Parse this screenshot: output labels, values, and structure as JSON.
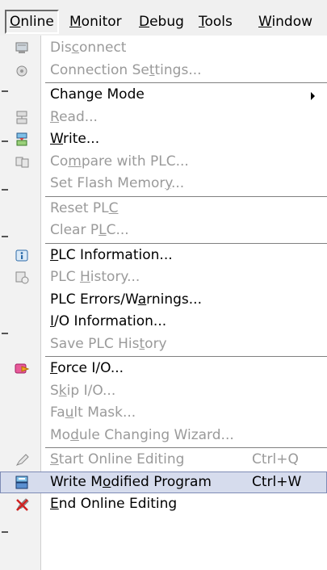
{
  "menubar": {
    "items": [
      {
        "pre": "",
        "ul": "O",
        "post": "nline"
      },
      {
        "pre": "",
        "ul": "M",
        "post": "onitor"
      },
      {
        "pre": "",
        "ul": "D",
        "post": "ebug"
      },
      {
        "pre": "",
        "ul": "T",
        "post": "ools"
      },
      {
        "pre": "",
        "ul": "W",
        "post": "indow"
      }
    ]
  },
  "menu": {
    "disconnect": {
      "pre": "Dis",
      "ul": "c",
      "post": "onnect"
    },
    "connection_settings": {
      "pre": "Connection Se",
      "ul": "t",
      "post": "tings..."
    },
    "change_mode": {
      "pre": "Chan",
      "ul": "g",
      "post": "e Mode"
    },
    "read": {
      "pre": "",
      "ul": "R",
      "post": "ead..."
    },
    "write": {
      "pre": "",
      "ul": "W",
      "post": "rite..."
    },
    "compare": {
      "pre": "Co",
      "ul": "m",
      "post": "pare with PLC..."
    },
    "set_flash": {
      "pre": "Set Flash Memor",
      "ul": "y",
      "post": "..."
    },
    "reset_plc": {
      "pre": "Reset PL",
      "ul": "C",
      "post": ""
    },
    "clear_plc": {
      "pre": "Clear P",
      "ul": "L",
      "post": "C..."
    },
    "plc_information": {
      "pre": "",
      "ul": "P",
      "post": "LC Information..."
    },
    "plc_history": {
      "pre": "PLC ",
      "ul": "H",
      "post": "istory..."
    },
    "plc_errors": {
      "pre": "PLC Errors/W",
      "ul": "a",
      "post": "rnings..."
    },
    "io_information": {
      "pre": "",
      "ul": "I",
      "post": "/O Information..."
    },
    "save_plc_history": {
      "pre": "Save PLC His",
      "ul": "t",
      "post": "ory"
    },
    "force_io": {
      "pre": "",
      "ul": "F",
      "post": "orce I/O..."
    },
    "skip_io": {
      "pre": "S",
      "ul": "k",
      "post": "ip I/O..."
    },
    "fault_mask": {
      "pre": "Fa",
      "ul": "u",
      "post": "lt Mask..."
    },
    "module_changing": {
      "pre": "Mo",
      "ul": "d",
      "post": "ule Changing Wizard..."
    },
    "start_online_editing": {
      "pre": "",
      "ul": "S",
      "post": "tart Online Editing",
      "shortcut": "Ctrl+Q"
    },
    "write_modified": {
      "pre": "Write M",
      "ul": "o",
      "post": "dified Program",
      "shortcut": "Ctrl+W"
    },
    "end_online_editing": {
      "pre": "",
      "ul": "E",
      "post": "nd Online Editing"
    }
  }
}
